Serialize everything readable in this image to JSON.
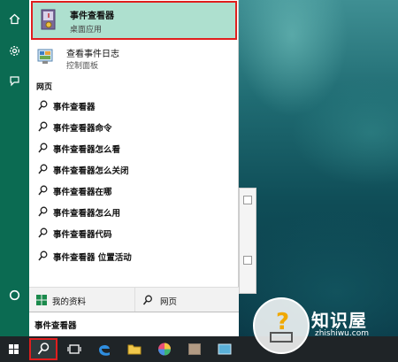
{
  "best_match": {
    "title": "事件查看器",
    "subtitle": "桌面应用"
  },
  "second_match": {
    "title": "查看事件日志",
    "subtitle": "控制面板"
  },
  "web_section": {
    "heading": "网页",
    "items": [
      "事件查看器",
      "事件查看器命令",
      "事件查看器怎么看",
      "事件查看器怎么关闭",
      "事件查看器在哪",
      "事件查看器怎么用",
      "事件查看器代码",
      "事件查看器 位置活动"
    ]
  },
  "bottom_bar": {
    "my_stuff": "我的资料",
    "web": "网页"
  },
  "search": {
    "value": "事件查看器"
  },
  "watermark": {
    "brand": "知识屋",
    "url": "zhishiwu.com"
  },
  "colors": {
    "accent": "#0b6b52",
    "highlight": "#aee0cf",
    "annotation": "#e01e1e",
    "taskbar": "#1f2427"
  }
}
